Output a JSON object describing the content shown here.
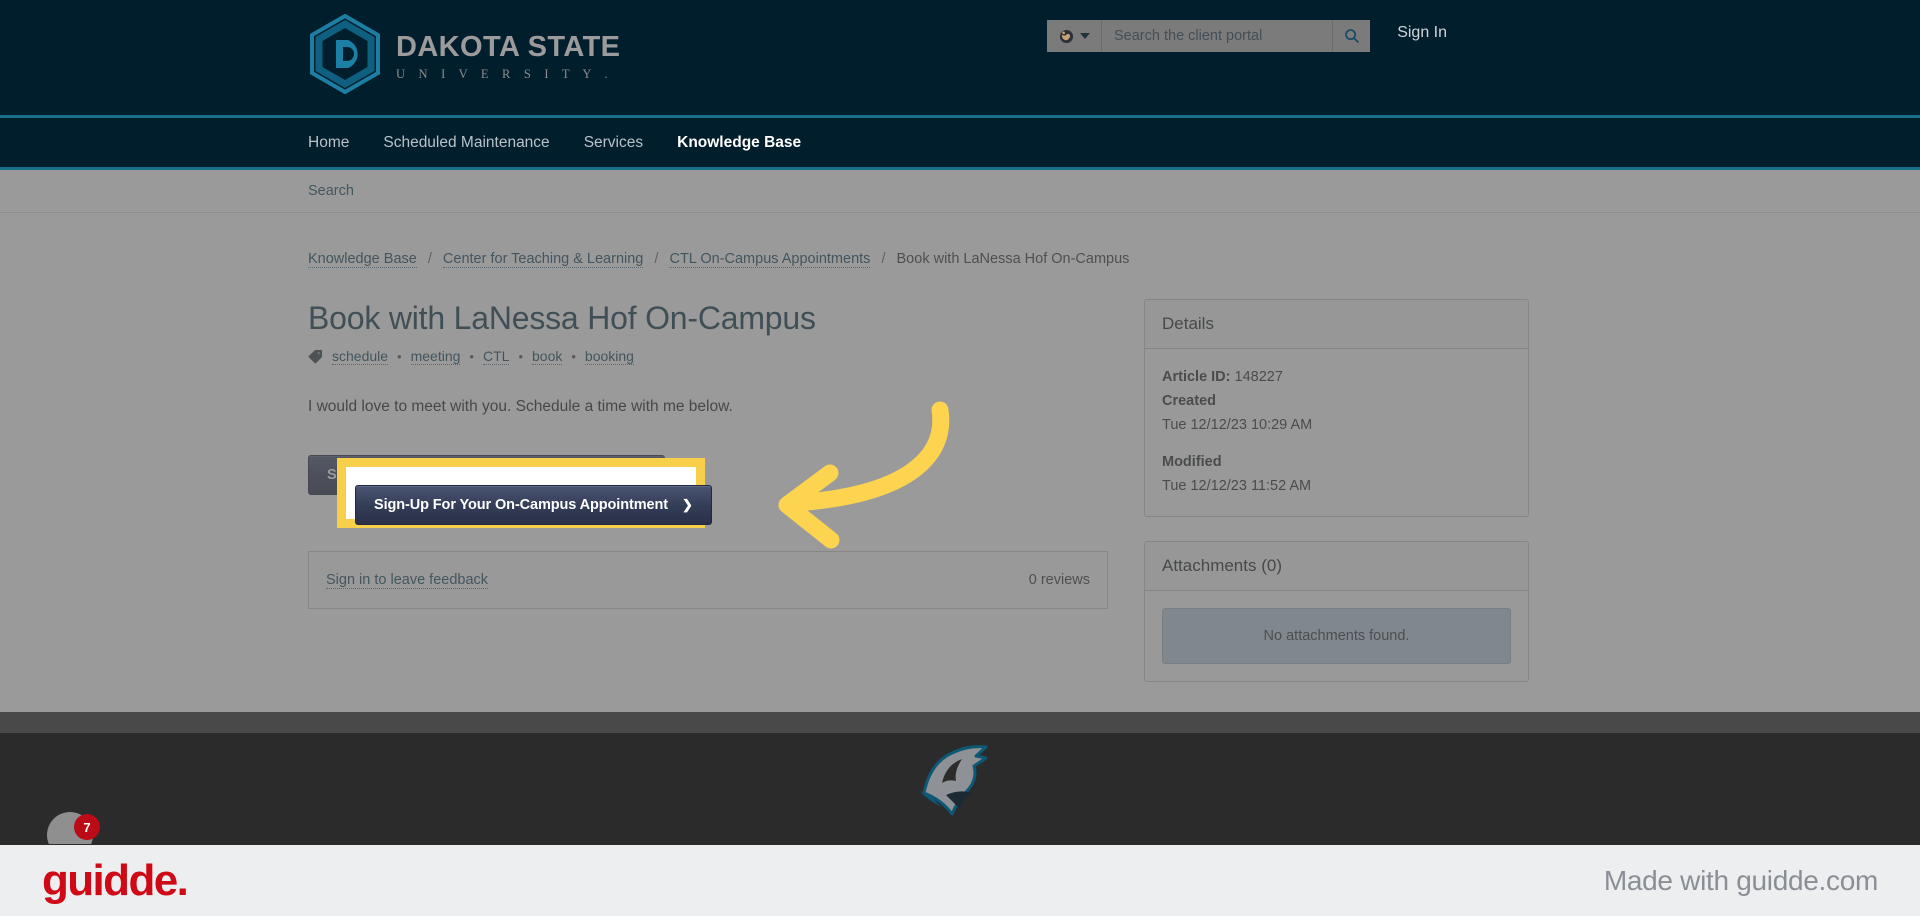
{
  "header": {
    "logo": {
      "mark": "dsu-hexagon-d-logo",
      "name": "DAKOTA STATE",
      "sub": "U N I V E R S I T Y ."
    },
    "search": {
      "scope_icon": "globe-icon",
      "placeholder": "Search the client portal",
      "value": "",
      "submit_icon": "search-icon"
    },
    "sign_in": "Sign In"
  },
  "nav": {
    "items": [
      {
        "label": "Home",
        "active": false
      },
      {
        "label": "Scheduled Maintenance",
        "active": false
      },
      {
        "label": "Services",
        "active": false
      },
      {
        "label": "Knowledge Base",
        "active": true
      }
    ]
  },
  "subnav": {
    "search_label": "Search"
  },
  "breadcrumb": {
    "links": [
      "Knowledge Base",
      "Center for Teaching & Learning",
      "CTL On-Campus Appointments"
    ],
    "current": "Book with LaNessa Hof On-Campus",
    "separator": "/"
  },
  "article": {
    "title": "Book with LaNessa Hof On-Campus",
    "tag_icon": "tag-icon",
    "tags": [
      "schedule",
      "meeting",
      "CTL",
      "book",
      "booking"
    ],
    "tag_separator": "•",
    "body": "I would love to meet with you. Schedule a time with me below.",
    "cta": {
      "label": "Sign-Up For Your On-Campus Appointment",
      "chevron": "❯"
    }
  },
  "feedback": {
    "sign_in_link": "Sign in to leave feedback",
    "reviews": "0 reviews"
  },
  "details_panel": {
    "title": "Details",
    "article_id_label": "Article ID:",
    "article_id": "148227",
    "created_label": "Created",
    "created_value": "Tue 12/12/23 10:29 AM",
    "modified_label": "Modified",
    "modified_value": "Tue 12/12/23 11:52 AM"
  },
  "attachments_panel": {
    "title": "Attachments (0)",
    "empty": "No attachments found."
  },
  "page_footer": {
    "mascot_icon": "trojan-helmet-mascot-icon"
  },
  "annotation": {
    "highlight_target": "Sign-Up For Your On-Campus Appointment",
    "arrow_icon": "curved-left-arrow-icon",
    "highlight_color": "#f8cf4a",
    "badge_count": "7"
  },
  "guidde_bar": {
    "logo": "guidde.",
    "made_with": "Made with guidde.com",
    "logo_color": "#cf0a16"
  }
}
